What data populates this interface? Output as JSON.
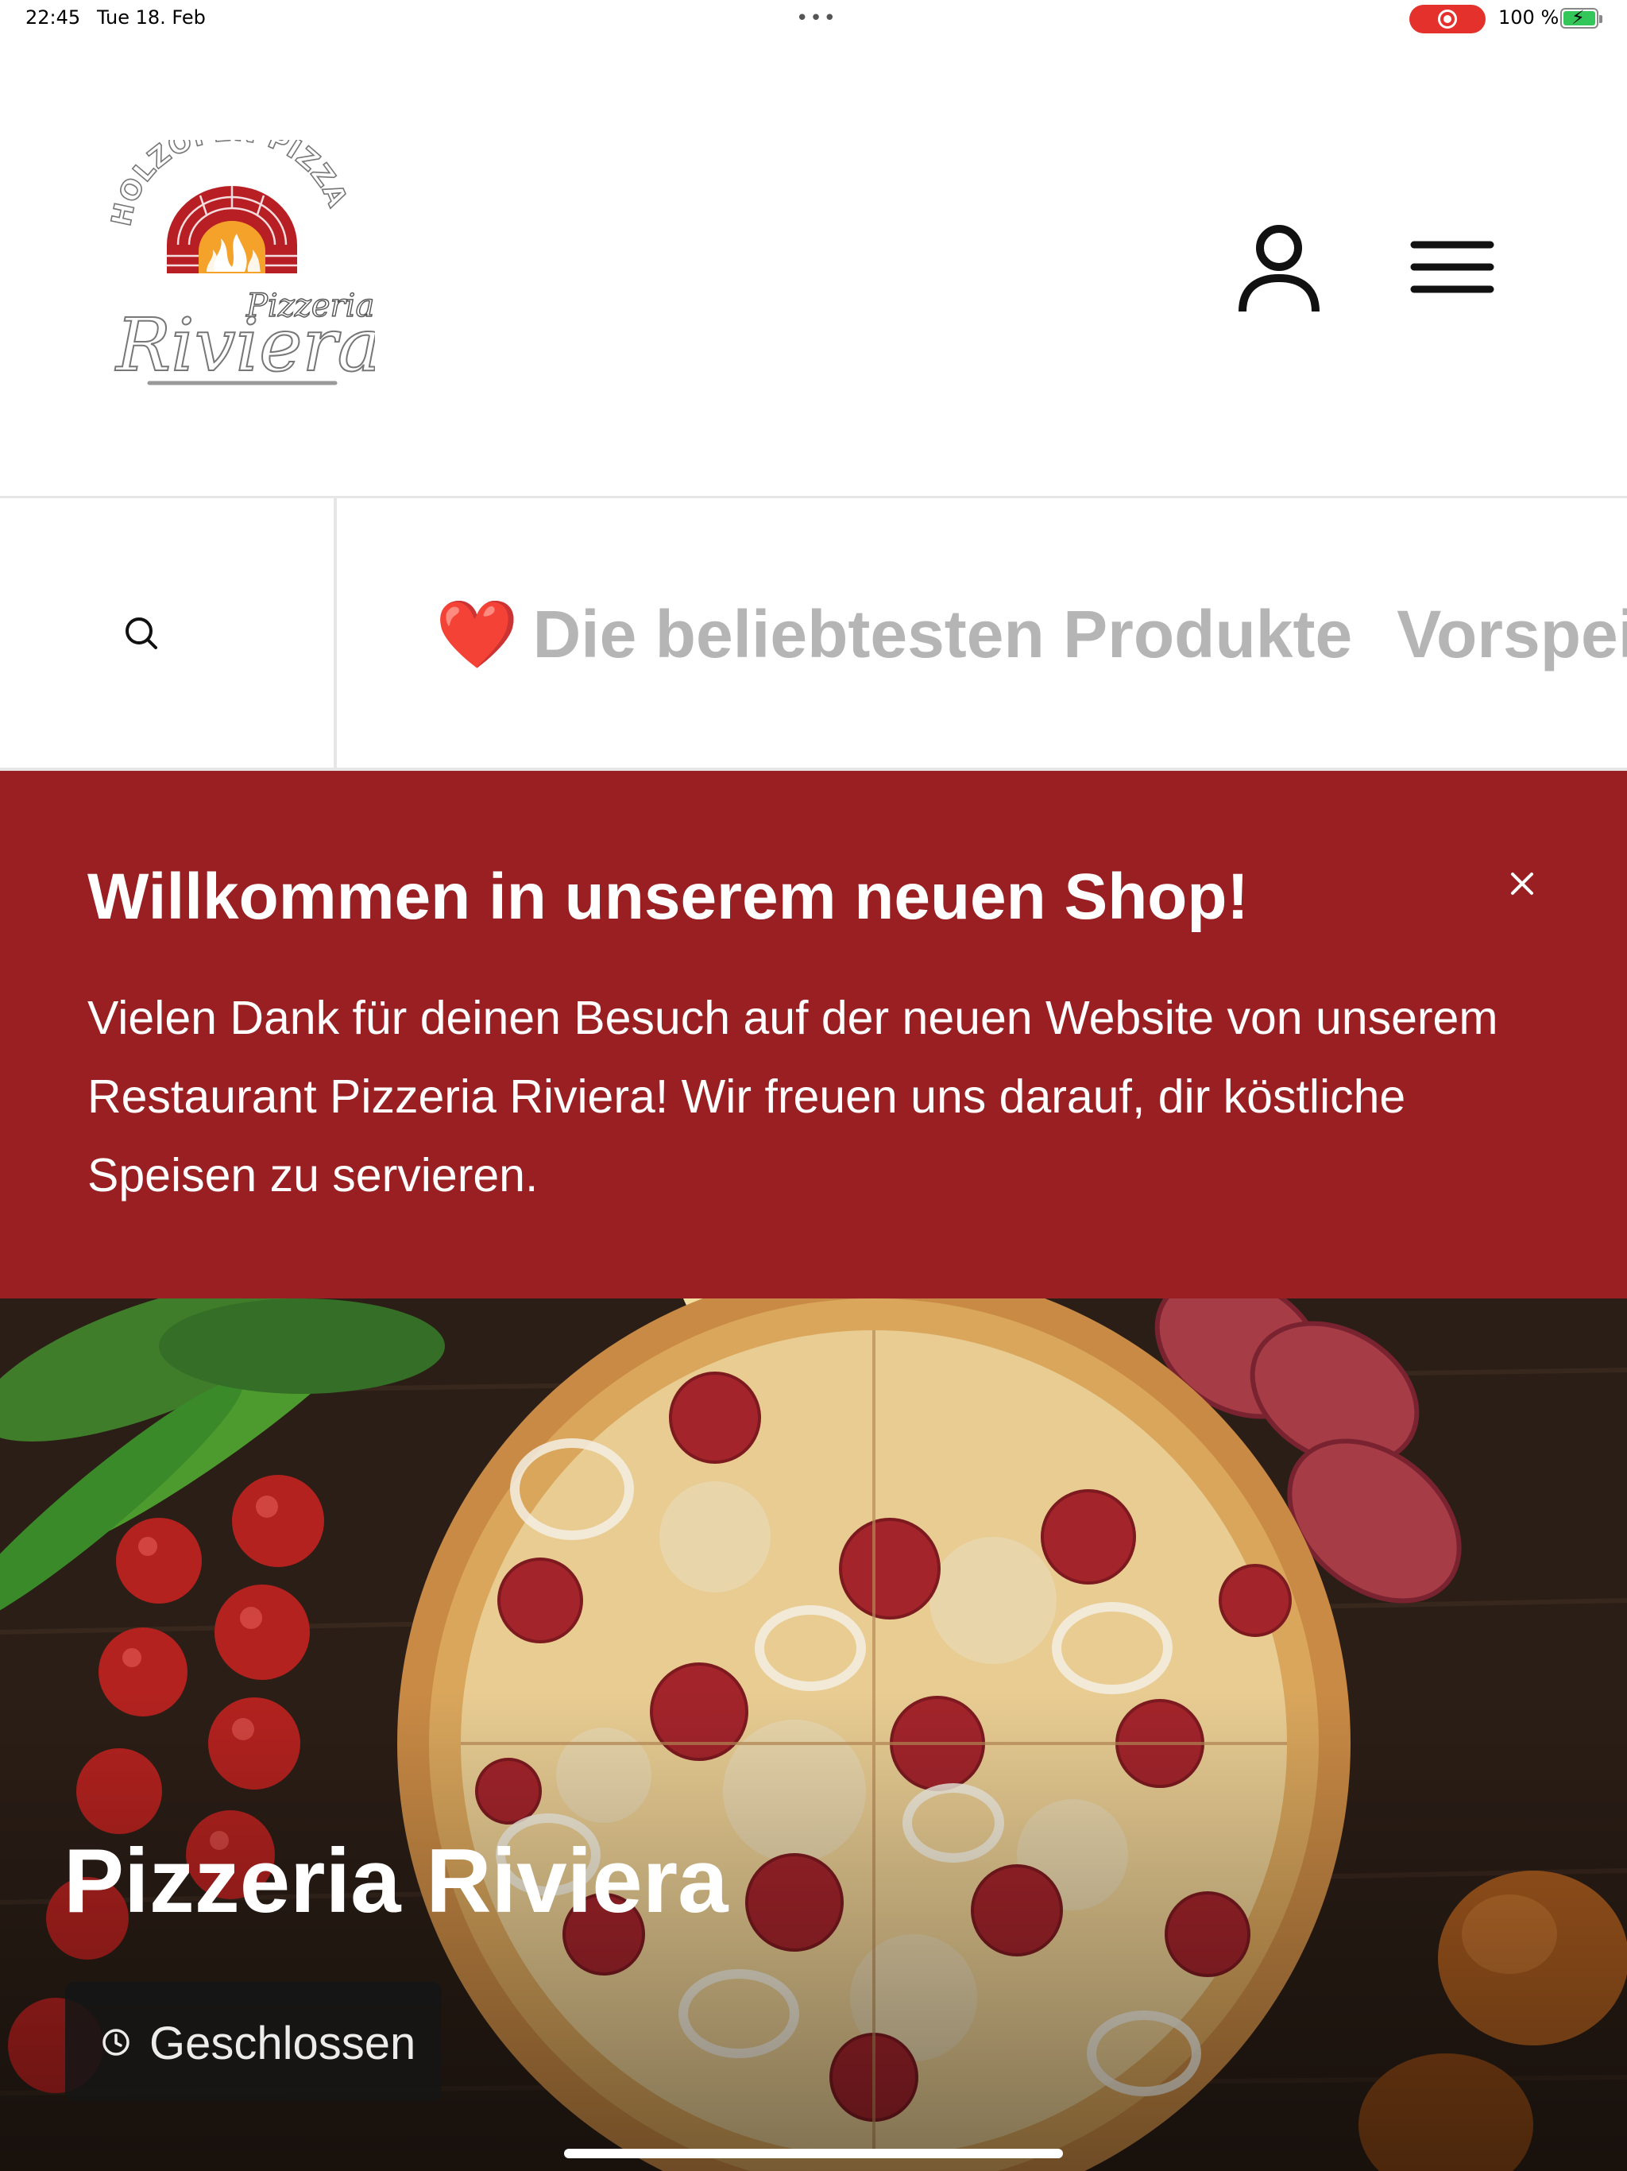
{
  "status_bar": {
    "time": "22:45",
    "date": "Tue 18. Feb",
    "battery_text": "100 %"
  },
  "header": {
    "logo": {
      "arc_text": "HOLZOFEN PIZZA",
      "script_top": "Pizzeria",
      "script_main": "Riviera"
    },
    "account_icon": "person-icon",
    "menu_icon": "hamburger-icon"
  },
  "category_bar": {
    "search_icon": "search-icon",
    "items": [
      {
        "emoji": "❤️",
        "label": "Die beliebtesten Produkte"
      },
      {
        "label": "Vorspei"
      }
    ]
  },
  "banner": {
    "title": "Willkommen in unserem neuen Shop!",
    "text": "Vielen Dank für deinen Besuch auf der neuen Website von unserem Restaurant Pizzeria Riviera! Wir freuen uns darauf, dir köstliche Speisen zu servieren.",
    "close_icon": "close-icon",
    "background_color": "#9a1f22"
  },
  "hero": {
    "title": "Pizzeria Riviera",
    "status_icon": "clock-icon",
    "status_label": "Geschlossen"
  }
}
